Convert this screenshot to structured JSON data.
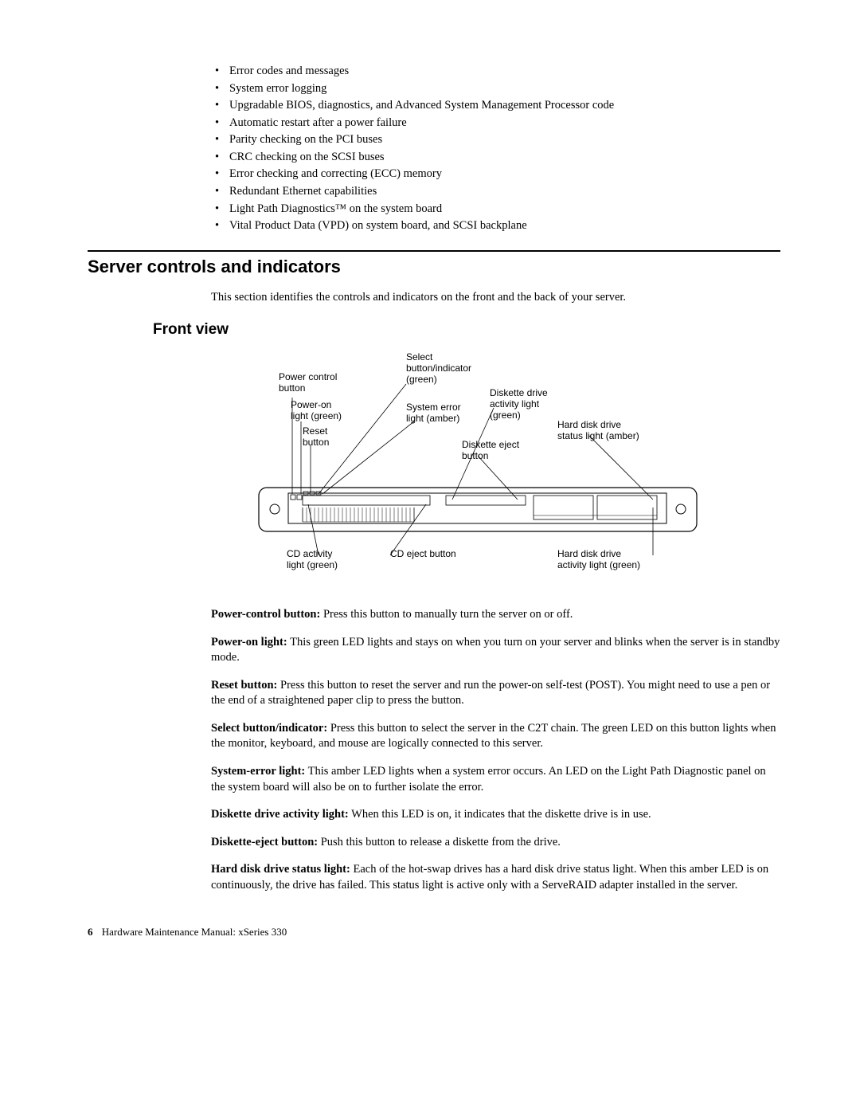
{
  "bullets": [
    "Error codes and messages",
    "System error logging",
    "Upgradable BIOS, diagnostics, and Advanced System Management Processor code",
    "Automatic restart after a power failure",
    "Parity checking on the PCI buses",
    "CRC checking on the SCSI buses",
    "Error checking and correcting (ECC) memory",
    "Redundant Ethernet capabilities",
    "Light Path Diagnostics™ on the system board",
    "Vital Product Data (VPD) on system board, and SCSI backplane"
  ],
  "heading1": "Server controls and indicators",
  "intro": "This section identifies the controls and indicators on the front and the back of your server.",
  "heading2": "Front view",
  "figure": {
    "callout_power_control_1": "Power control",
    "callout_power_control_2": "button",
    "callout_power_on_1": "Power-on",
    "callout_power_on_2": "light (green)",
    "callout_reset_1": "Reset",
    "callout_reset_2": "button",
    "callout_select_1": "Select",
    "callout_select_2": "button/indicator",
    "callout_select_3": "(green)",
    "callout_syserr_1": "System error",
    "callout_syserr_2": "light (amber)",
    "callout_diskette_act_1": "Diskette drive",
    "callout_diskette_act_2": "activity light",
    "callout_diskette_act_3": "(green)",
    "callout_diskette_eject_1": "Diskette eject",
    "callout_diskette_eject_2": "button",
    "callout_hdd_status_1": "Hard disk drive",
    "callout_hdd_status_2": "status light (amber)",
    "callout_cd_activity_1": "CD activity",
    "callout_cd_activity_2": "light (green)",
    "callout_cd_eject": "CD eject button",
    "callout_hdd_activity_1": "Hard disk drive",
    "callout_hdd_activity_2": "activity light (green)"
  },
  "definitions": [
    {
      "term": "Power-control button:",
      "desc": "  Press this button to manually turn the server on or off."
    },
    {
      "term": "Power-on light:",
      "desc": "  This green LED lights and stays on when you turn on your server and blinks when the server is in standby mode."
    },
    {
      "term": "Reset button:",
      "desc": "  Press this button to reset the server and run the power-on self-test (POST).  You might need to use a pen or the end of a straightened paper clip to press the button."
    },
    {
      "term": "Select button/indicator:",
      "desc": "  Press this button to select the server in the C2T chain.  The green LED on this button lights when the monitor, keyboard, and mouse are logically connected to this server."
    },
    {
      "term": "System-error light:",
      "desc": "  This amber LED lights when a system error occurs.  An LED on the Light Path Diagnostic panel on the system board will also be on to further isolate the error."
    },
    {
      "term": "Diskette drive activity light:",
      "desc": "  When this LED is on, it indicates that the diskette drive is in use."
    },
    {
      "term": "Diskette-eject button:",
      "desc": "  Push this button to release a diskette from the drive."
    },
    {
      "term": "Hard disk drive status light:",
      "desc": "  Each of the hot-swap drives has a hard disk drive status light.  When this amber LED is on continuously, the drive has failed.  This status light is active only with a ServeRAID adapter installed in the server."
    }
  ],
  "footer": {
    "page": "6",
    "title": "Hardware Maintenance Manual: xSeries 330"
  }
}
